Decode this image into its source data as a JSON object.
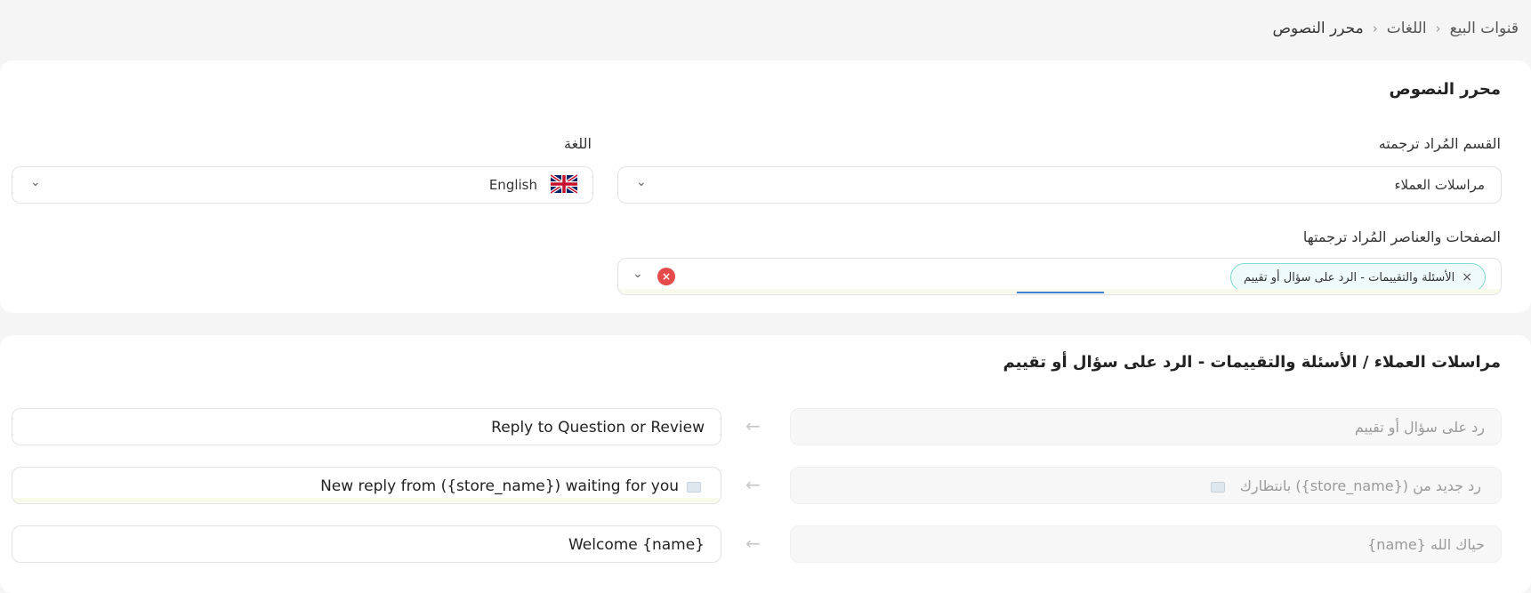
{
  "breadcrumb": {
    "items": [
      "قنوات البيع",
      "اللغات",
      "محرر النصوص"
    ],
    "separator": "›"
  },
  "card_settings": {
    "title": "محرر النصوص",
    "section_label": "القسم المُراد ترجمته",
    "section_value": "مراسلات العملاء",
    "language_label": "اللغة",
    "language_value": "English",
    "language_flag": "uk-flag-icon",
    "pages_label": "الصفحات والعناصر المُراد ترجمتها",
    "pages_tag": "الأسئلة والتقييمات - الرد على سؤال أو تقييم",
    "tag_remove": "×",
    "clear_icon": "×",
    "chevron": "⌄"
  },
  "card_translations": {
    "title": "مراسلات العملاء / الأسئلة والتقييمات - الرد على سؤال أو تقييم",
    "arrow": "←",
    "rows": [
      {
        "source": "رد على سؤال أو تقييم",
        "target": "Reply to Question or Review"
      },
      {
        "source": "رد جديد من ({store_name}) بانتظارك",
        "target": "New reply from ({store_name}) waiting for you"
      },
      {
        "source": "حياك الله {name}",
        "target": "Welcome {name}"
      }
    ]
  },
  "colors": {
    "accent_teal": "#7fd9d2",
    "clear_red": "#e54b4b",
    "progress_blue": "#3f7fd0"
  }
}
